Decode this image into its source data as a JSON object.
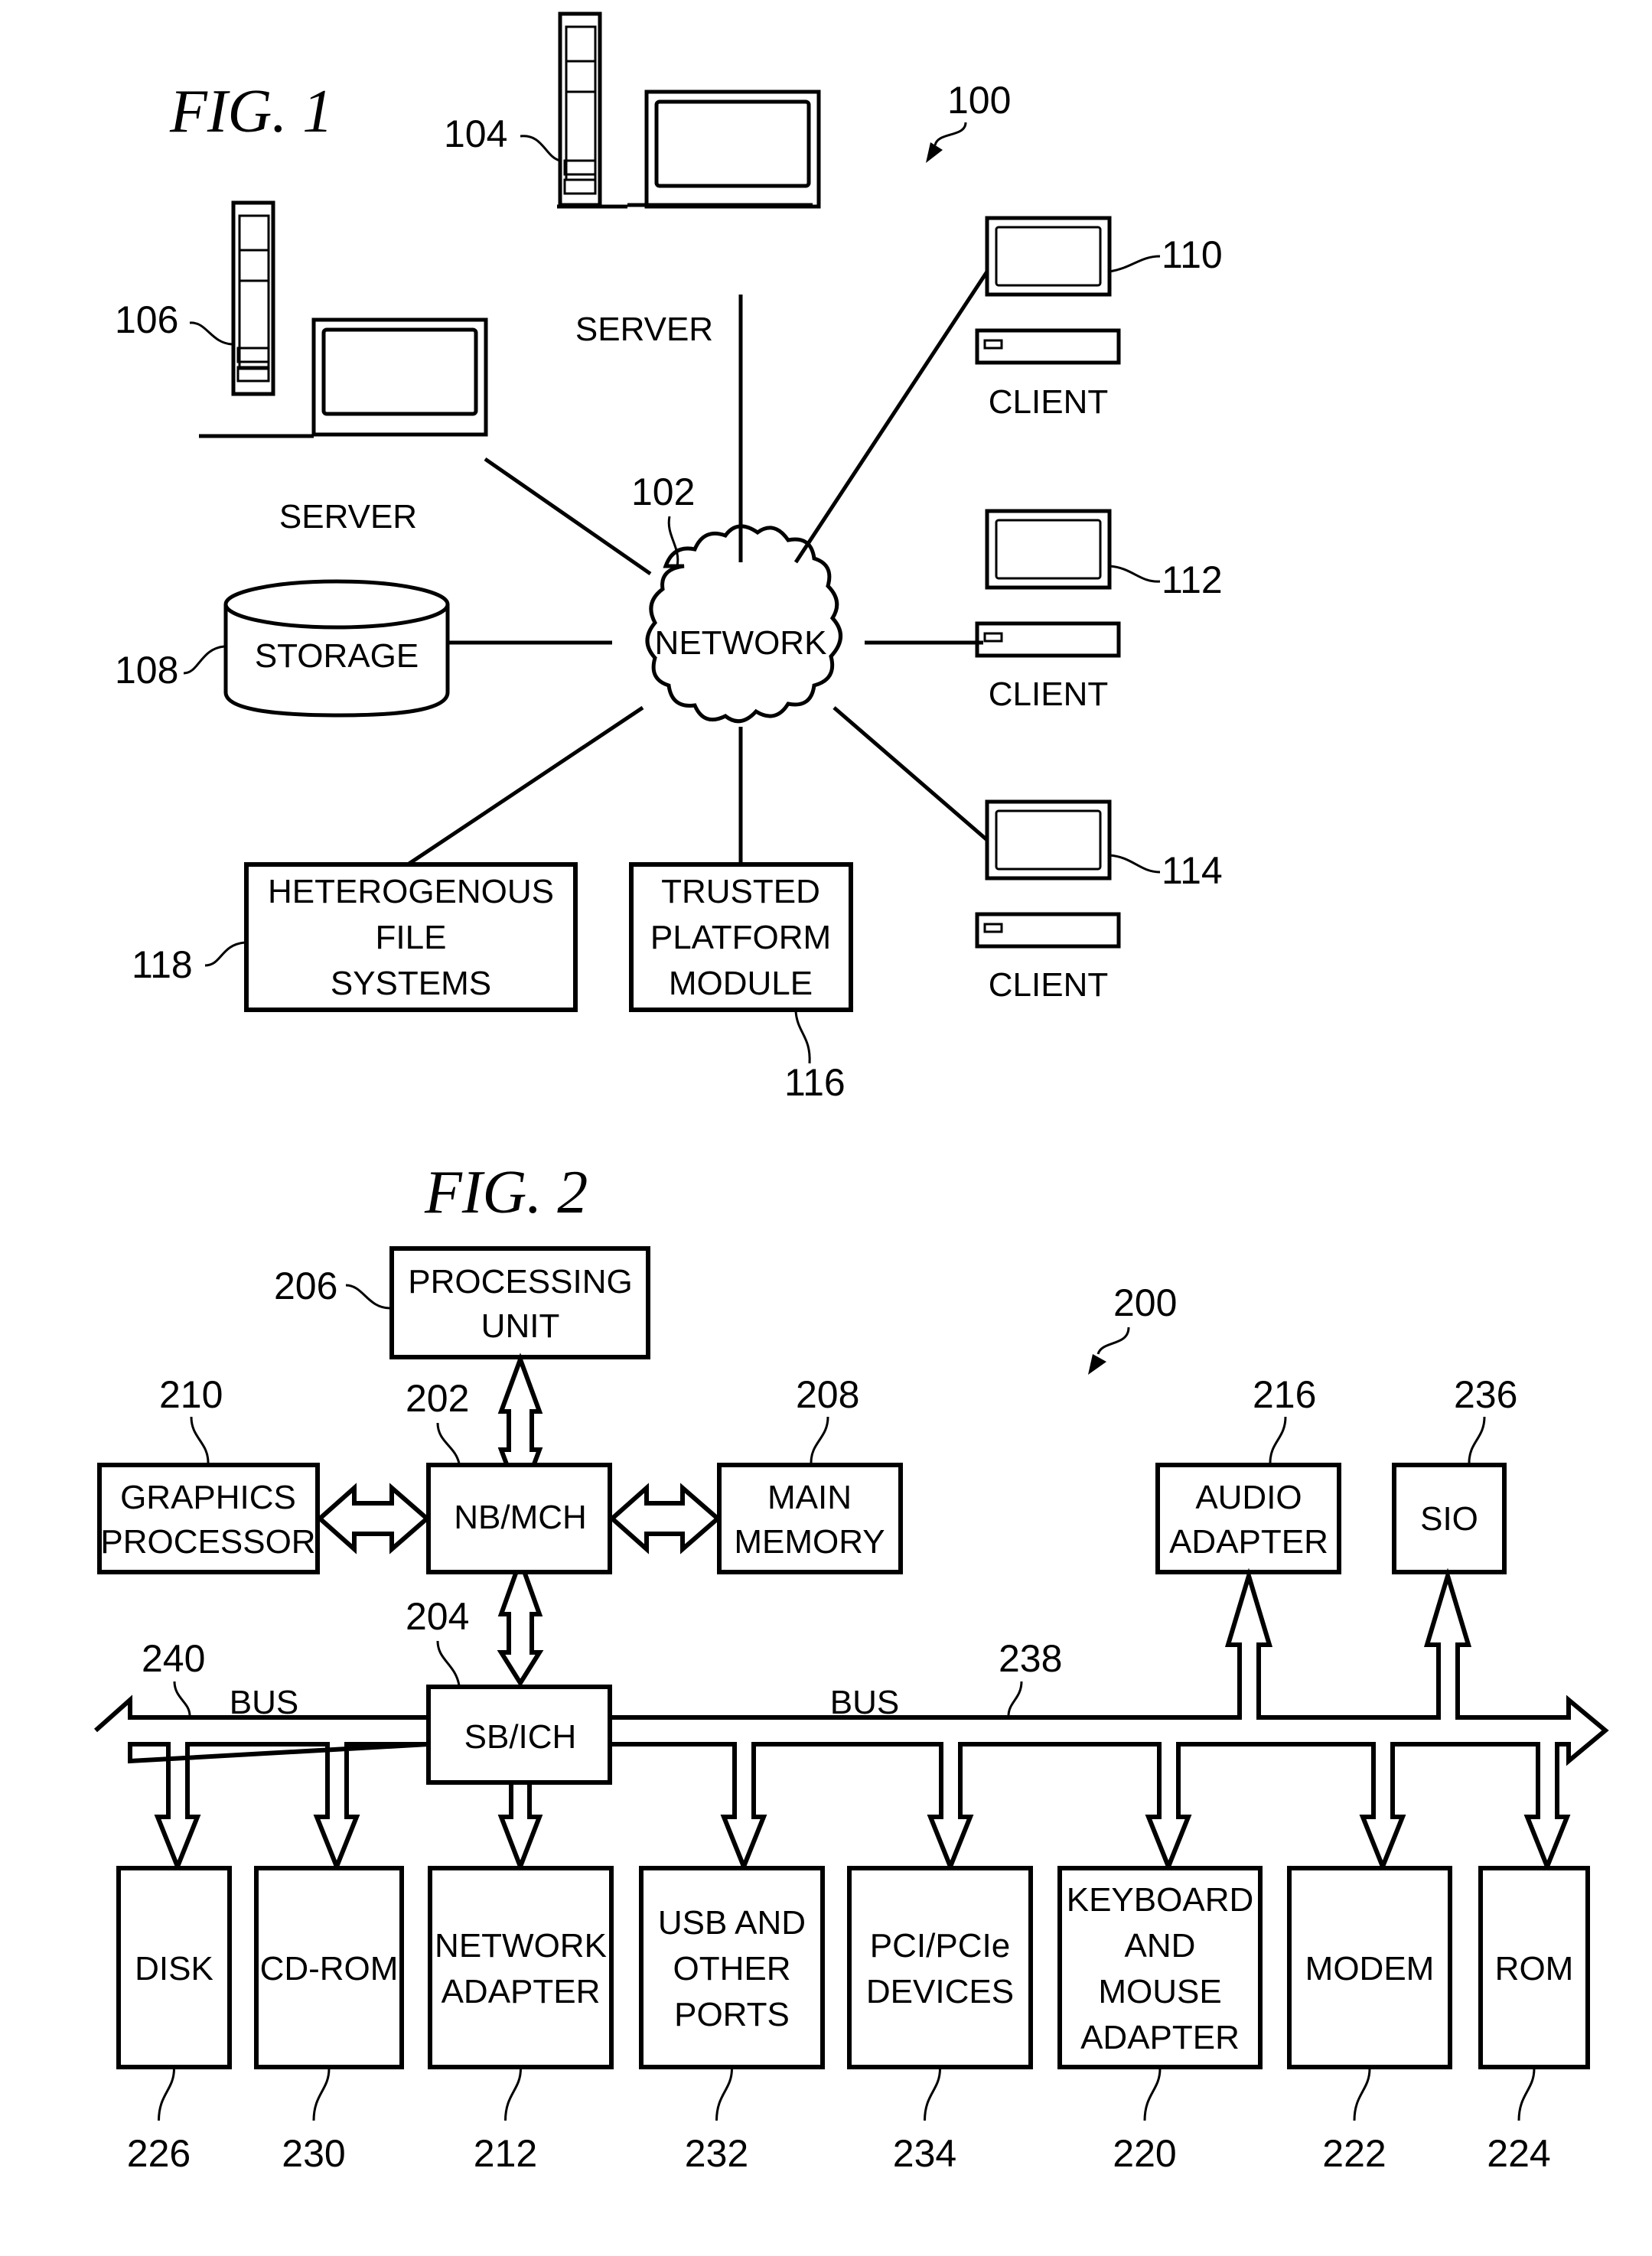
{
  "fig1": {
    "title": "FIG. 1",
    "system_ref": "100",
    "network": {
      "label": "NETWORK",
      "ref": "102"
    },
    "servers": [
      {
        "label": "SERVER",
        "ref": "104"
      },
      {
        "label": "SERVER",
        "ref": "106"
      }
    ],
    "storage": {
      "label": "STORAGE",
      "ref": "108"
    },
    "clients": [
      {
        "label": "CLIENT",
        "ref": "110"
      },
      {
        "label": "CLIENT",
        "ref": "112"
      },
      {
        "label": "CLIENT",
        "ref": "114"
      }
    ],
    "tpm": {
      "lines": [
        "TRUSTED",
        "PLATFORM",
        "MODULE"
      ],
      "ref": "116"
    },
    "hfs": {
      "lines": [
        "HETEROGENOUS",
        "FILE",
        "SYSTEMS"
      ],
      "ref": "118"
    }
  },
  "fig2": {
    "title": "FIG. 2",
    "system_ref": "200",
    "processing_unit": {
      "lines": [
        "PROCESSING",
        "UNIT"
      ],
      "ref": "206"
    },
    "nb_mch": {
      "label": "NB/MCH",
      "ref": "202"
    },
    "sb_ich": {
      "label": "SB/ICH",
      "ref": "204"
    },
    "graphics": {
      "lines": [
        "GRAPHICS",
        "PROCESSOR"
      ],
      "ref": "210"
    },
    "main_memory": {
      "lines": [
        "MAIN",
        "MEMORY"
      ],
      "ref": "208"
    },
    "audio": {
      "lines": [
        "AUDIO",
        "ADAPTER"
      ],
      "ref": "216"
    },
    "sio": {
      "label": "SIO",
      "ref": "236"
    },
    "bus_left": {
      "label": "BUS",
      "ref": "240"
    },
    "bus_right": {
      "label": "BUS",
      "ref": "238"
    },
    "devices": [
      {
        "lines": [
          "DISK"
        ],
        "ref": "226"
      },
      {
        "lines": [
          "CD-ROM"
        ],
        "ref": "230"
      },
      {
        "lines": [
          "NETWORK",
          "ADAPTER"
        ],
        "ref": "212"
      },
      {
        "lines": [
          "USB AND",
          "OTHER",
          "PORTS"
        ],
        "ref": "232"
      },
      {
        "lines": [
          "PCI/PCIe",
          "DEVICES"
        ],
        "ref": "234"
      },
      {
        "lines": [
          "KEYBOARD",
          "AND",
          "MOUSE",
          "ADAPTER"
        ],
        "ref": "220"
      },
      {
        "lines": [
          "MODEM"
        ],
        "ref": "222"
      },
      {
        "lines": [
          "ROM"
        ],
        "ref": "224"
      }
    ]
  }
}
